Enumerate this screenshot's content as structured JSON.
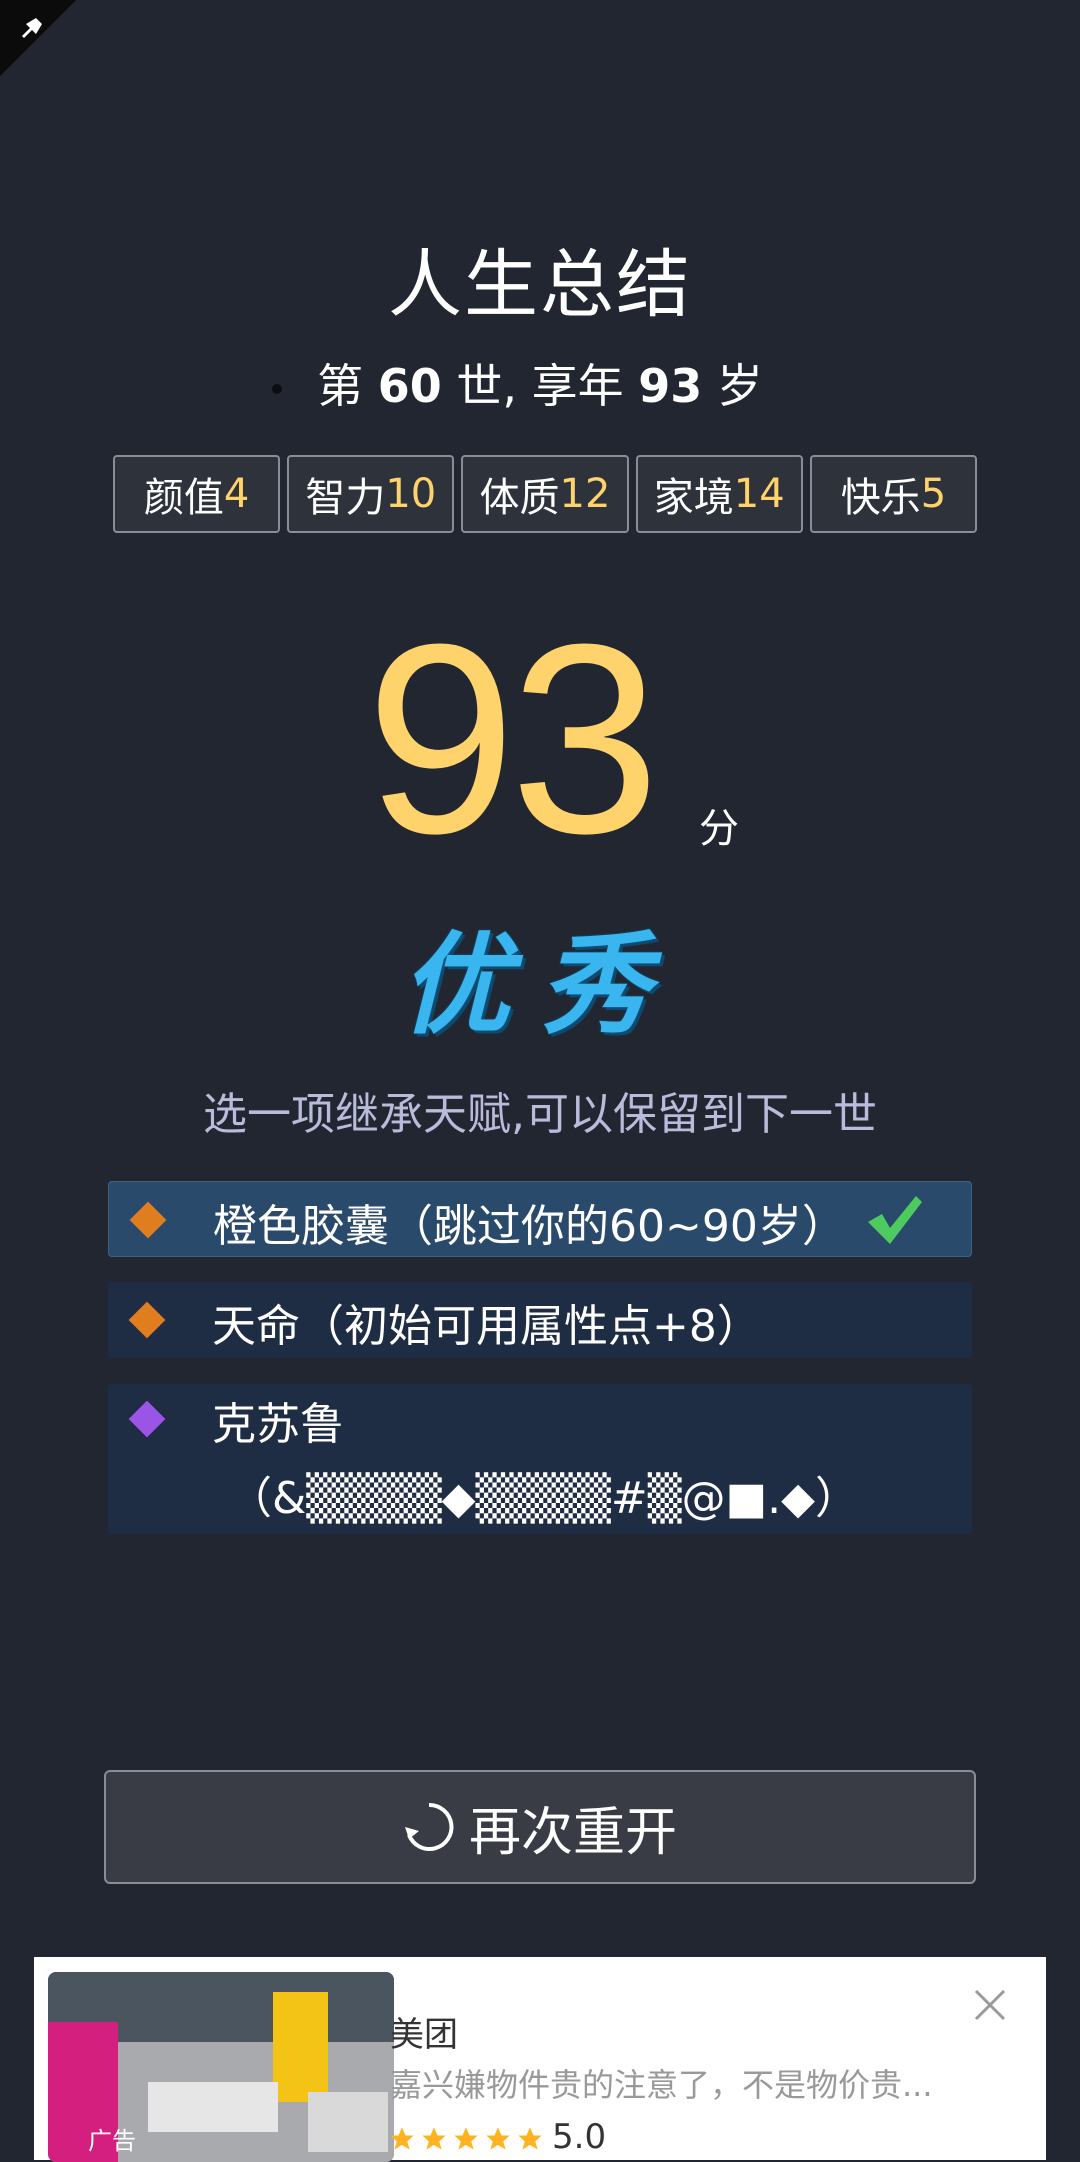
{
  "header": {
    "title": "人生总结"
  },
  "summary": {
    "prefix": "第",
    "generation": "60",
    "mid": "世, 享年",
    "age": "93",
    "suffix": "岁"
  },
  "attributes": [
    {
      "label": "颜值",
      "value": "4"
    },
    {
      "label": "智力",
      "value": "10"
    },
    {
      "label": "体质",
      "value": "12"
    },
    {
      "label": "家境",
      "value": "14"
    },
    {
      "label": "快乐",
      "value": "5"
    }
  ],
  "score": {
    "value": "93",
    "unit": "分"
  },
  "grade": {
    "label": "优秀"
  },
  "instruction": "选一项继承天赋,可以保留到下一世",
  "talents": [
    {
      "label": "橙色胶囊（跳过你的60~90岁）",
      "color": "#e07d1e",
      "selected": true
    },
    {
      "label": "天命（初始可用属性点+8）",
      "color": "#e07d1e",
      "selected": false
    },
    {
      "label_line1": "克苏鲁",
      "label_line2": "（&▒▒▒▒◆▒▒▒▒#▒@■.◆）",
      "color": "#9b55e6",
      "selected": false
    }
  ],
  "actions": {
    "restart_label": "再次重开"
  },
  "ad": {
    "tag": "广告",
    "title": "美团",
    "description": "嘉兴嫌物件贵的注意了，不是物价贵...",
    "rating": "5.0",
    "stars": 5
  },
  "colors": {
    "background": "#222630",
    "accent_yellow": "#ffd36b",
    "grade_blue": "#39b6ef",
    "selected_bg": "#2a4a6c",
    "check_green": "#4ecb5f"
  }
}
